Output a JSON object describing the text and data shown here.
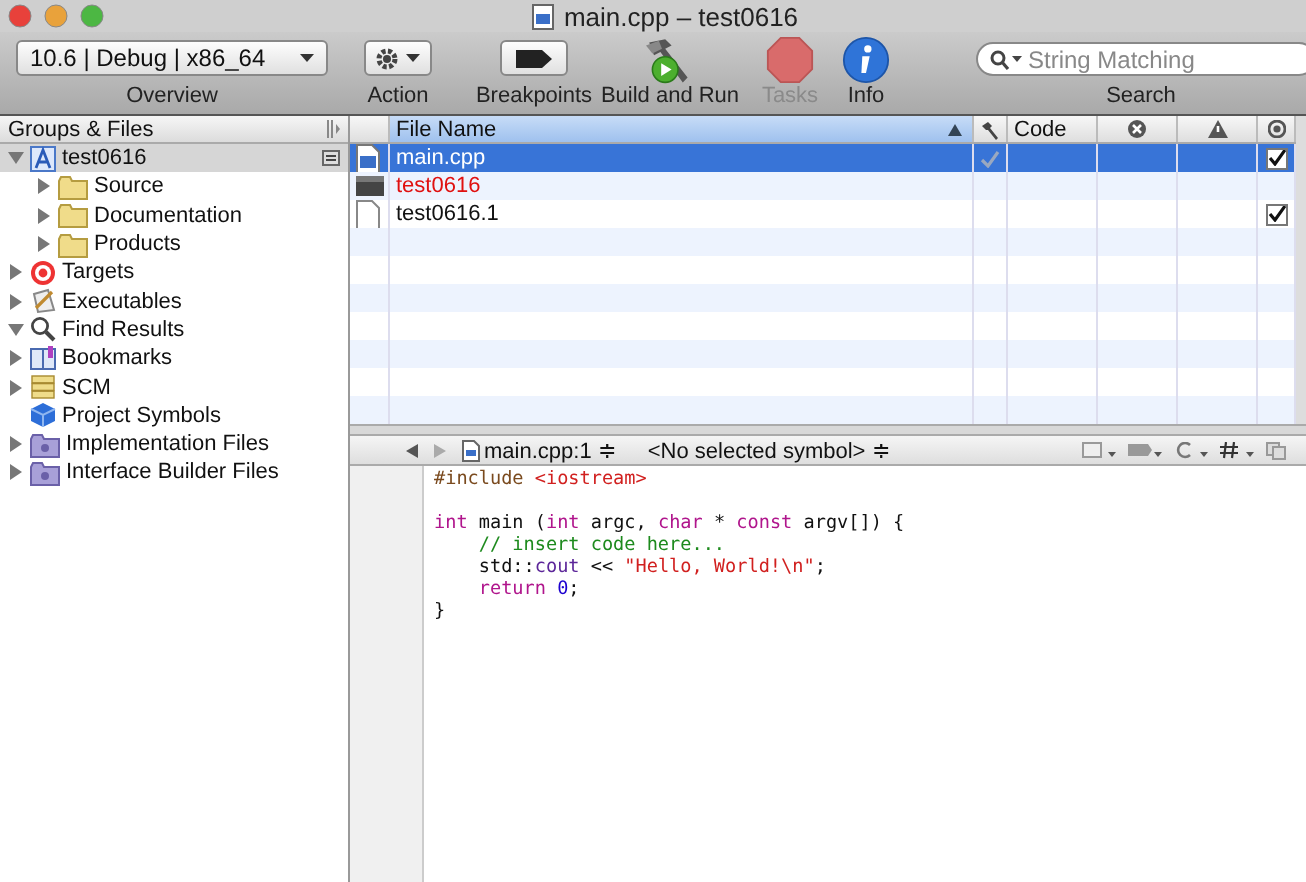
{
  "window": {
    "title": "main.cpp – test0616"
  },
  "toolbar": {
    "overview": {
      "value": "10.6 | Debug | x86_64",
      "label": "Overview"
    },
    "items": [
      {
        "kind": "action",
        "label": "Action",
        "disabled": false
      },
      {
        "kind": "breakpoints",
        "label": "Breakpoints",
        "disabled": false
      },
      {
        "kind": "build",
        "label": "Build and Run",
        "disabled": false
      },
      {
        "kind": "tasks",
        "label": "Tasks",
        "disabled": true
      },
      {
        "kind": "info",
        "label": "Info",
        "disabled": false
      }
    ],
    "search": {
      "placeholder": "String Matching",
      "label": "Search"
    }
  },
  "sidebar": {
    "title": "Groups & Files",
    "items": [
      {
        "label": "test0616",
        "kind": "project",
        "expanded": true,
        "selected": true,
        "children": [
          {
            "label": "Source",
            "kind": "folder",
            "expanded": false,
            "selected": false
          },
          {
            "label": "Documentation",
            "kind": "folder",
            "expanded": false,
            "selected": false
          },
          {
            "label": "Products",
            "kind": "folder",
            "expanded": false,
            "selected": false
          }
        ]
      },
      {
        "label": "Targets",
        "kind": "target",
        "expanded": false,
        "selected": false
      },
      {
        "label": "Executables",
        "kind": "executable",
        "expanded": false,
        "selected": false
      },
      {
        "label": "Find Results",
        "kind": "find",
        "expanded": true,
        "selected": false
      },
      {
        "label": "Bookmarks",
        "kind": "bookmark",
        "expanded": false,
        "selected": false
      },
      {
        "label": "SCM",
        "kind": "scm",
        "expanded": false,
        "selected": false
      },
      {
        "label": "Project Symbols",
        "kind": "symbols",
        "selected": false
      },
      {
        "label": "Implementation Files",
        "kind": "smartgroup",
        "expanded": false,
        "selected": false
      },
      {
        "label": "Interface Builder Files",
        "kind": "smartgroup",
        "expanded": false,
        "selected": false
      }
    ]
  },
  "files": {
    "columns": [
      "File Name",
      "Code"
    ],
    "rows": [
      {
        "name": "main.cpp",
        "kind": "source",
        "selected": true,
        "missing": false,
        "built": true,
        "target": true
      },
      {
        "name": "test0616",
        "kind": "executable",
        "selected": false,
        "missing": true,
        "built": false
      },
      {
        "name": "test0616.1",
        "kind": "document",
        "selected": false,
        "missing": false,
        "built": false,
        "target": true
      }
    ]
  },
  "editor": {
    "file": "main.cpp:1 ≑",
    "symbol": "<No selected symbol> ≑",
    "lines": [
      {
        "kind": "code",
        "indented": false,
        "tokens": [
          {
            "kind": "preprocessor",
            "text": "#include "
          },
          {
            "kind": "string",
            "text": "<iostream>"
          }
        ]
      },
      {
        "kind": "blank"
      },
      {
        "kind": "code",
        "indented": false,
        "tokens": [
          {
            "kind": "keyword",
            "text": "int"
          },
          {
            "kind": "plain",
            "text": " main ("
          },
          {
            "kind": "keyword",
            "text": "int"
          },
          {
            "kind": "plain",
            "text": " argc, "
          },
          {
            "kind": "keyword",
            "text": "char"
          },
          {
            "kind": "plain",
            "text": " * "
          },
          {
            "kind": "keyword",
            "text": "const"
          },
          {
            "kind": "plain",
            "text": " argv[]) {"
          }
        ]
      },
      {
        "kind": "code",
        "indented": true,
        "tokens": [
          {
            "kind": "comment",
            "text": "// insert code here..."
          }
        ]
      },
      {
        "kind": "code",
        "indented": true,
        "tokens": [
          {
            "kind": "plain",
            "text": "std::"
          },
          {
            "kind": "library",
            "text": "cout"
          },
          {
            "kind": "plain",
            "text": " << "
          },
          {
            "kind": "string",
            "text": "\"Hello, World!\\n\""
          },
          {
            "kind": "plain",
            "text": ";"
          }
        ]
      },
      {
        "kind": "code",
        "indented": true,
        "tokens": [
          {
            "kind": "keyword",
            "text": "return "
          },
          {
            "kind": "number",
            "text": "0"
          },
          {
            "kind": "plain",
            "text": ";"
          }
        ]
      },
      {
        "kind": "code",
        "indented": false,
        "tokens": [
          {
            "kind": "plain",
            "text": "}"
          }
        ]
      }
    ]
  }
}
